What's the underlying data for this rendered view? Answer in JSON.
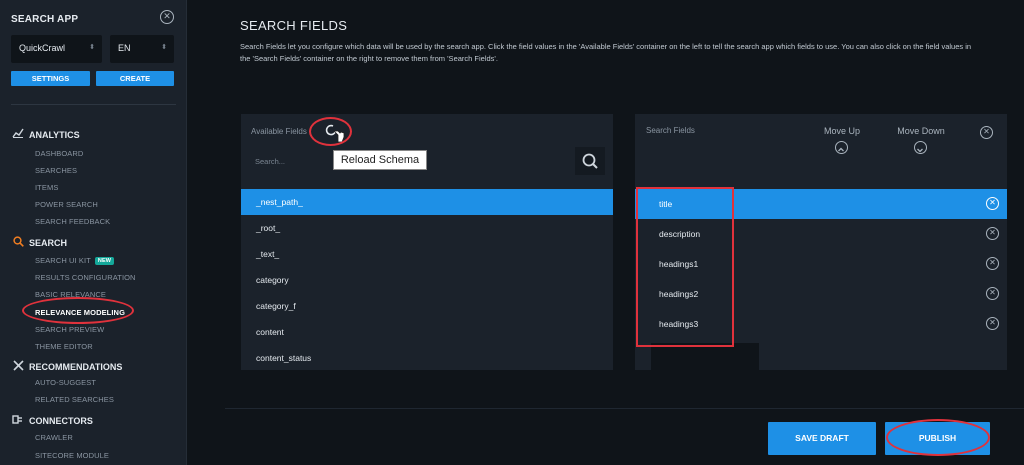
{
  "sidebar": {
    "title": "SEARCH APP",
    "close_icon": "close-circle-icon",
    "app_select": "QuickCrawl",
    "lang_select": "EN",
    "settings_label": "SETTINGS",
    "create_label": "CREATE",
    "sections": [
      {
        "label": "ANALYTICS",
        "icon": "chart-icon",
        "items": [
          "DASHBOARD",
          "SEARCHES",
          "ITEMS",
          "POWER SEARCH",
          "SEARCH FEEDBACK"
        ]
      },
      {
        "label": "SEARCH",
        "icon": "search-icon",
        "items": [
          "SEARCH UI KIT",
          "RESULTS CONFIGURATION",
          "BASIC RELEVANCE",
          "RELEVANCE MODELING",
          "SEARCH PREVIEW",
          "THEME EDITOR"
        ],
        "badge": "NEW"
      },
      {
        "label": "RECOMMENDATIONS",
        "icon": "shuffle-icon",
        "items": [
          "AUTO-SUGGEST",
          "RELATED SEARCHES"
        ]
      },
      {
        "label": "CONNECTORS",
        "icon": "plug-icon",
        "items": [
          "CRAWLER",
          "SITECORE MODULE"
        ]
      }
    ]
  },
  "main": {
    "title": "SEARCH FIELDS",
    "description": "Search Fields let you configure which data will be used by the search app. Click the field values in the 'Available Fields' container on the left to tell the search app which fields to use. You can also click on the field values in the 'Search Fields' container on the right to remove them from 'Search Fields'."
  },
  "available": {
    "label": "Available Fields",
    "search_placeholder": "Search...",
    "tooltip": "Reload Schema",
    "fields": [
      "_nest_path_",
      "_root_",
      "_text_",
      "category",
      "category_f",
      "content",
      "content_status"
    ]
  },
  "selected": {
    "label": "Search Fields",
    "move_up": "Move Up",
    "move_down": "Move Down",
    "fields": [
      "title",
      "description",
      "headings1",
      "headings2",
      "headings3"
    ]
  },
  "footer": {
    "save_draft": "SAVE DRAFT",
    "publish": "PUBLISH"
  },
  "colors": {
    "accent": "#1e90e6",
    "highlight": "#e0323c",
    "background": "#0f1419",
    "panel": "#1b222b"
  }
}
